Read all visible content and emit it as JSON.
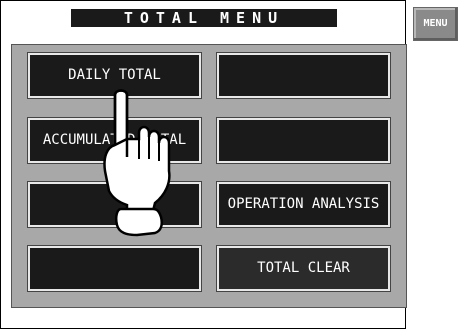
{
  "screen": {
    "title": "TOTAL MENU"
  },
  "menu_button": {
    "label": "MENU"
  },
  "keys": [
    {
      "label": "DAILY TOTAL"
    },
    {
      "label": ""
    },
    {
      "label": "ACCUMULATED TOTAL"
    },
    {
      "label": ""
    },
    {
      "label": ""
    },
    {
      "label": "OPERATION ANALYSIS"
    },
    {
      "label": ""
    },
    {
      "label": "TOTAL CLEAR"
    }
  ],
  "overlay": {
    "icon": "pointing-hand-icon"
  }
}
